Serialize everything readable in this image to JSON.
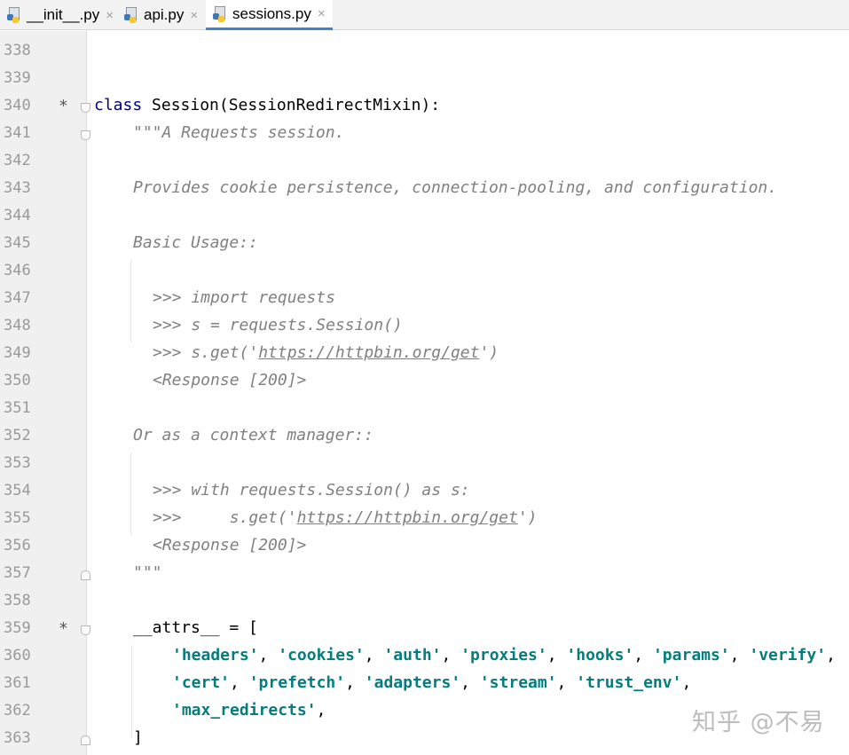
{
  "tabs": [
    {
      "label": "__init__.py"
    },
    {
      "label": "api.py"
    },
    {
      "label": "sessions.py"
    }
  ],
  "tab_close_glyph": "×",
  "lines": [
    {
      "num": "338"
    },
    {
      "num": "339"
    },
    {
      "num": "340",
      "marker": "*",
      "t1": "class",
      "t2": " Session(SessionRedirectMixin):"
    },
    {
      "num": "341",
      "t1": "\"\"\"A Requests session."
    },
    {
      "num": "342"
    },
    {
      "num": "343",
      "t1": "Provides cookie persistence, connection-pooling, and configuration."
    },
    {
      "num": "344"
    },
    {
      "num": "345",
      "t1": "Basic Usage::"
    },
    {
      "num": "346"
    },
    {
      "num": "347",
      "t1": ">>> import requests"
    },
    {
      "num": "348",
      "t1": ">>> s = requests.Session()"
    },
    {
      "num": "349",
      "t1": ">>> s.get('",
      "u1": "https://httpbin.org/get",
      "t2": "')"
    },
    {
      "num": "350",
      "t1": "<Response [200]>"
    },
    {
      "num": "351"
    },
    {
      "num": "352",
      "t1": "Or as a context manager::"
    },
    {
      "num": "353"
    },
    {
      "num": "354",
      "t1": ">>> with requests.Session() as s:"
    },
    {
      "num": "355",
      "t1": ">>>     s.get('",
      "u1": "https://httpbin.org/get",
      "t2": "')"
    },
    {
      "num": "356",
      "t1": "<Response [200]>"
    },
    {
      "num": "357",
      "t1": "\"\"\""
    },
    {
      "num": "358"
    },
    {
      "num": "359",
      "marker": "*",
      "t1": "__attrs__ = ["
    },
    {
      "num": "360",
      "s1": "'headers'",
      "p1": ", ",
      "s2": "'cookies'",
      "p2": ", ",
      "s3": "'auth'",
      "p3": ", ",
      "s4": "'proxies'",
      "p4": ", ",
      "s5": "'hooks'",
      "p5": ", ",
      "s6": "'params'",
      "p6": ", ",
      "s7": "'verify'",
      "p7": ","
    },
    {
      "num": "361",
      "s1": "'cert'",
      "p1": ", ",
      "s2": "'prefetch'",
      "p2": ", ",
      "s3": "'adapters'",
      "p3": ", ",
      "s4": "'stream'",
      "p4": ", ",
      "s5": "'trust_env'",
      "p5": ","
    },
    {
      "num": "362",
      "s1": "'max_redirects'",
      "p1": ","
    },
    {
      "num": "363",
      "t1": "]"
    }
  ],
  "watermark": "知乎 @不易"
}
